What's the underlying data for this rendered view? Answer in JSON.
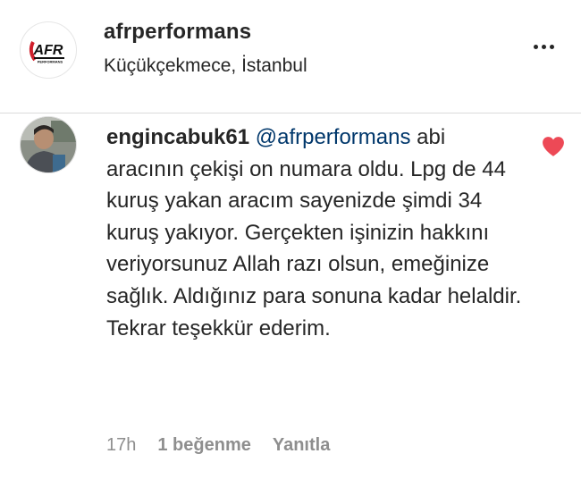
{
  "post_header": {
    "username": "afrperformans",
    "location": "Küçükçekmece, İstanbul",
    "logo_text": "AFR",
    "logo_subtext": "PERFORMANS",
    "more_icon": "more-horizontal-icon"
  },
  "comment": {
    "author": "engincabuk61",
    "mention": "@afrperformans",
    "text": " abi aracının çekişi on numara oldu. Lpg de 44 kuruş yakan aracım sayenizde şimdi 34 kuruş yakıyor. Gerçekten işinizin hakkını veriyorsunuz Allah razı olsun, emeğinize sağlık. Aldığınız para sonuna kadar helaldir. Tekrar teşekkür ederim.",
    "time": "17h",
    "likes": "1 beğenme",
    "reply_label": "Yanıtla",
    "liked": true
  },
  "colors": {
    "text": "#262626",
    "secondary": "#8e8e8e",
    "mention": "#00376b",
    "heart": "#ed4956",
    "logo_red": "#d0202c"
  }
}
